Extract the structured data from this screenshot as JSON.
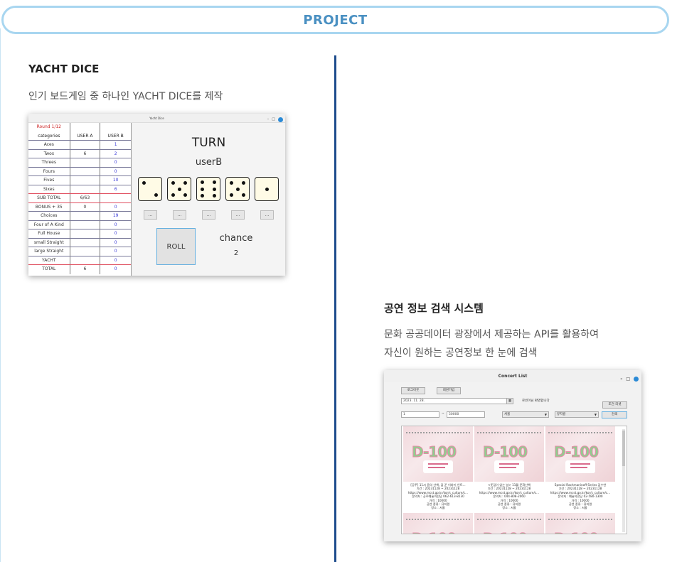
{
  "header": {
    "title": "PROJECT"
  },
  "project1": {
    "title": "YACHT DICE",
    "desc": "인기 보드게임 중 하나인 YACHT DICE를 제작",
    "window": {
      "title": "Yacht Dice",
      "round_label": "Round 1/12",
      "columns": [
        "categories",
        "USER A",
        "USER B"
      ],
      "rows": [
        {
          "cat": "Aces",
          "a": "",
          "b": "1"
        },
        {
          "cat": "Twos",
          "a": "6",
          "b": "2"
        },
        {
          "cat": "Threes",
          "a": "",
          "b": "0"
        },
        {
          "cat": "Fours",
          "a": "",
          "b": "0"
        },
        {
          "cat": "Fives",
          "a": "",
          "b": "10"
        },
        {
          "cat": "Sixes",
          "a": "",
          "b": "6"
        },
        {
          "cat": "SUB TOTAL",
          "a": "6/63",
          "b": ""
        },
        {
          "cat": "BONUS + 35",
          "a": "0",
          "b": "0"
        },
        {
          "cat": "Choices",
          "a": "",
          "b": "19"
        },
        {
          "cat": "Four of A Kind",
          "a": "",
          "b": "0"
        },
        {
          "cat": "Full House",
          "a": "",
          "b": "0"
        },
        {
          "cat": "small Straight",
          "a": "",
          "b": "0"
        },
        {
          "cat": "large Straight",
          "a": "",
          "b": "0"
        },
        {
          "cat": "YACHT",
          "a": "",
          "b": "0"
        },
        {
          "cat": "TOTAL",
          "a": "6",
          "b": "0"
        }
      ],
      "turn_label": "TURN",
      "current_user": "userB",
      "dice_values": [
        2,
        5,
        6,
        5,
        1
      ],
      "hold_label": "...",
      "roll_label": "ROLL",
      "chance_label": "chance",
      "chance_count": "2"
    }
  },
  "project2": {
    "title": "공연 정보 검색 시스템",
    "desc_line1": "문화 공공데이터 광장에서 제공하는 API를 활용하여",
    "desc_line2": "자신이 원하는 공연정보 한 눈에 검색",
    "window": {
      "title": "Concert List",
      "login_btn": "로그아웃",
      "signup_btn": "회원가입",
      "date_value": "2023. 11. 28.",
      "welcome_text": "로빈이님 환영합니다",
      "reset_btn": "조건 리셋",
      "price_min": "1",
      "tilde": "~",
      "price_max": "50000",
      "region_select": "서울",
      "genre_select": "뮤지컬",
      "search_btn": "검색",
      "poster_text": "D-100",
      "cards": [
        {
          "title": "[공주] 11시 음악 산책, 꿈 꾼 이야기 인트...",
          "period": "기간 : 20231128 ~ 20231128",
          "url": "https://www.mcst.go.kr/kor/s_culture/c...",
          "contact": "문의처 : 공주예술의전당 062-613-8230",
          "price": "가격 : 10000",
          "genre": "공연 종류 : 뮤지컬",
          "place": "장소 : 서울"
        },
        {
          "title": "<뜻깊이 있는 날> 11월 문화산책",
          "period": "기간 : 20231128 ~ 20231128",
          "url": "https://www.mcst.go.kr/kor/s_culture/c...",
          "contact": "문의처 : 044-808-2060",
          "price": "가격 : 10000",
          "genre": "공연 종류 : 뮤지컬",
          "place": "장소 : 서울"
        },
        {
          "title": "Special Rachmaninoff Series 김수연",
          "period": "기간 : 20231128 ~ 20231128",
          "url": "https://www.mcst.go.kr/kor/s_culture/c...",
          "contact": "문의처 : 예술의전당 02-580-1300",
          "price": "가격 : 10000",
          "genre": "공연 종류 : 뮤지컬",
          "place": "장소 : 서울"
        }
      ]
    }
  }
}
